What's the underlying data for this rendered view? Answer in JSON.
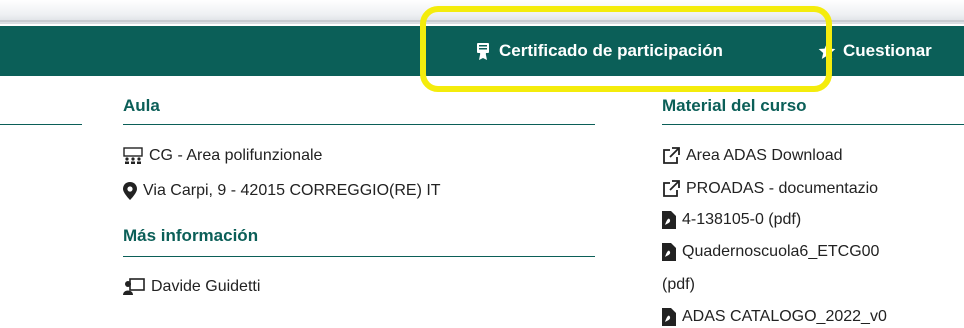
{
  "nav": {
    "certificate_label": "Certificado de participación",
    "questionnaire_label": "Cuestionar"
  },
  "aula": {
    "heading": "Aula",
    "location": "CG - Area polifunzionale",
    "address": "Via Carpi, 9 - 42015 CORREGGIO(RE) IT"
  },
  "more_info": {
    "heading": "Más información",
    "contact": "Davide Guidetti"
  },
  "material": {
    "heading": "Material del curso",
    "items": [
      {
        "label": "Area ADAS Download",
        "icon": "external-link-icon"
      },
      {
        "label": "PROADAS - documentazio",
        "icon": "external-link-icon"
      },
      {
        "label": "4-138105-0 (pdf)",
        "icon": "pdf-file-icon"
      },
      {
        "label": "Quadernoscuola6_ETCG00",
        "icon": "pdf-file-icon"
      },
      {
        "label": "(pdf)",
        "icon": ""
      },
      {
        "label": "ADAS CATALOGO_2022_v0",
        "icon": "pdf-file-icon"
      }
    ]
  },
  "colors": {
    "teal": "#0b5f58",
    "highlight": "#f4ec0c"
  }
}
